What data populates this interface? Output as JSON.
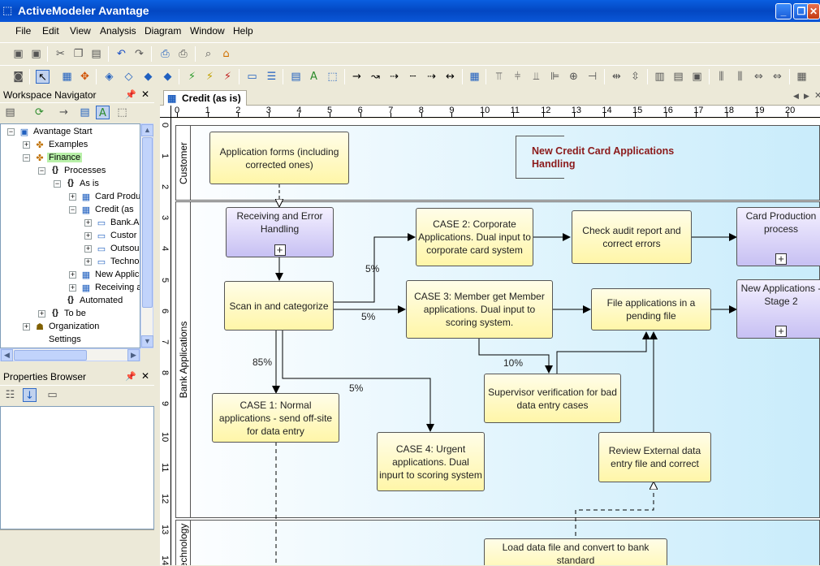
{
  "window": {
    "title": "ActiveModeler Avantage"
  },
  "menu": [
    "File",
    "Edit",
    "View",
    "Analysis",
    "Diagram",
    "Window",
    "Help"
  ],
  "navigator": {
    "title": "Workspace Navigator",
    "tree": [
      {
        "label": "Avantage Start",
        "icon": "workspace-icon",
        "exp": "-",
        "level": 0
      },
      {
        "label": "Examples",
        "icon": "project-icon",
        "exp": "+",
        "level": 1
      },
      {
        "label": "Finance",
        "icon": "project-icon",
        "exp": "-",
        "level": 1,
        "selected": true
      },
      {
        "label": "Processes",
        "icon": "braces-icon",
        "exp": "-",
        "level": 2
      },
      {
        "label": "As is",
        "icon": "braces-icon",
        "exp": "-",
        "level": 3
      },
      {
        "label": "Card Produ",
        "icon": "diagram-icon",
        "exp": "+",
        "level": 4
      },
      {
        "label": "Credit (as",
        "icon": "diagram-icon",
        "exp": "-",
        "level": 4
      },
      {
        "label": "Bank.A",
        "icon": "lane-icon",
        "exp": "+",
        "level": 5
      },
      {
        "label": "Custor",
        "icon": "lane-icon",
        "exp": "+",
        "level": 5
      },
      {
        "label": "Outsou",
        "icon": "lane-icon",
        "exp": "+",
        "level": 5
      },
      {
        "label": "Techno",
        "icon": "lane-icon",
        "exp": "+",
        "level": 5
      },
      {
        "label": "New Applic",
        "icon": "diagram-icon",
        "exp": "+",
        "level": 4
      },
      {
        "label": "Receiving a",
        "icon": "diagram-icon",
        "exp": "+",
        "level": 4
      },
      {
        "label": "Automated",
        "icon": "braces-icon",
        "exp": "",
        "level": 3
      },
      {
        "label": "To be",
        "icon": "braces-icon",
        "exp": "+",
        "level": 2
      },
      {
        "label": "Organization",
        "icon": "org-icon",
        "exp": "+",
        "level": 1
      },
      {
        "label": "Settings",
        "icon": "settings-icon",
        "exp": "",
        "level": 1
      }
    ]
  },
  "properties": {
    "title": "Properties Browser"
  },
  "document": {
    "tab_label": "Credit (as is)"
  },
  "ruler": {
    "h": [
      "0",
      "1",
      "2",
      "3",
      "4",
      "5",
      "6",
      "7",
      "8",
      "9",
      "10",
      "11",
      "12",
      "13",
      "14",
      "15",
      "16",
      "17",
      "18",
      "19",
      "20"
    ],
    "v": [
      "0",
      "1",
      "2",
      "3",
      "4",
      "5",
      "6",
      "7",
      "8",
      "9",
      "10",
      "11",
      "12",
      "13",
      "14"
    ]
  },
  "lanes": {
    "customer": "Customer",
    "bank": "Bank Applications",
    "tech": "Technology"
  },
  "annotation": "New Credit Card Applications Handling",
  "boxes": {
    "app_forms": "Application forms (including corrected ones)",
    "receiving": "Receiving and Error Handling",
    "scan": "Scan in and categorize",
    "case1": "CASE 1: Normal applications - send off-site for data entry",
    "case2": "CASE 2: Corporate Applications.  Dual input to corporate card system",
    "case3": "CASE 3: Member get Member applications. Dual input to scoring system.",
    "case4": "CASE 4: Urgent applications. Dual inpurt to scoring system",
    "audit": "Check audit report and correct errors",
    "card_prod": "Card Production process",
    "pending": "File applications in a pending file",
    "new_apps": "New Applications - Stage 2",
    "supervisor": "Supervisor verification for bad data entry cases",
    "review": "Review External data entry file and correct",
    "load": "Load data file and convert to bank standard"
  },
  "percents": {
    "p5a": "5%",
    "p5b": "5%",
    "p85": "85%",
    "p5c": "5%",
    "p10": "10%"
  }
}
